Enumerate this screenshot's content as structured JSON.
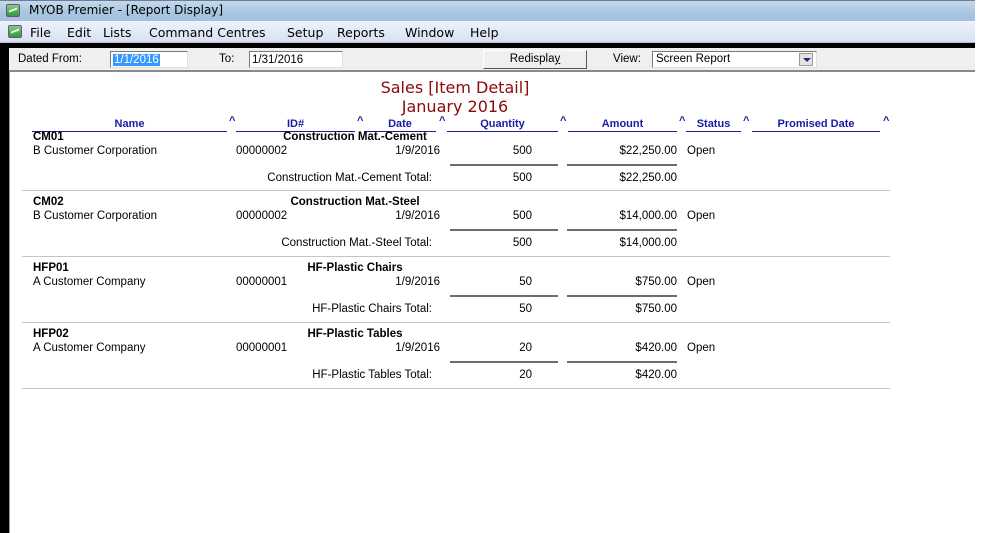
{
  "window": {
    "title": "MYOB Premier - [Report Display]",
    "app_icon": "myob-app-icon"
  },
  "menu": {
    "icon": "myob-document-icon",
    "items": [
      "File",
      "Edit",
      "Lists",
      "Command Centres",
      "Setup",
      "Reports",
      "Window",
      "Help"
    ]
  },
  "toolbar": {
    "dated_from_label": "Dated From:",
    "dated_from_value": "1/1/2016",
    "to_label": "To:",
    "to_value": "1/31/2016",
    "redisplay_label": "Redispla",
    "redisplay_mnemonic": "y",
    "view_label": "View:",
    "view_value": "Screen Report"
  },
  "report": {
    "title": "Sales [Item Detail]",
    "period": "January 2016",
    "columns": [
      "Name",
      "ID#",
      "Date",
      "Quantity",
      "Amount",
      "Status",
      "Promised Date"
    ],
    "sort_glyph": "^",
    "groups": [
      {
        "code": "CM01",
        "item_name": "Construction Mat.-Cement",
        "rows": [
          {
            "name": "B Customer Corporation",
            "id": "00000002",
            "date": "1/9/2016",
            "quantity": "500",
            "amount": "$22,250.00",
            "status": "Open",
            "promised_date": ""
          }
        ],
        "total_label": "Construction Mat.-Cement Total:",
        "total_quantity": "500",
        "total_amount": "$22,250.00"
      },
      {
        "code": "CM02",
        "item_name": "Construction Mat.-Steel",
        "rows": [
          {
            "name": "B Customer Corporation",
            "id": "00000002",
            "date": "1/9/2016",
            "quantity": "500",
            "amount": "$14,000.00",
            "status": "Open",
            "promised_date": ""
          }
        ],
        "total_label": "Construction Mat.-Steel Total:",
        "total_quantity": "500",
        "total_amount": "$14,000.00"
      },
      {
        "code": "HFP01",
        "item_name": "HF-Plastic Chairs",
        "rows": [
          {
            "name": "A Customer Company",
            "id": "00000001",
            "date": "1/9/2016",
            "quantity": "50",
            "amount": "$750.00",
            "status": "Open",
            "promised_date": ""
          }
        ],
        "total_label": "HF-Plastic Chairs Total:",
        "total_quantity": "50",
        "total_amount": "$750.00"
      },
      {
        "code": "HFP02",
        "item_name": "HF-Plastic Tables",
        "rows": [
          {
            "name": "A Customer Company",
            "id": "00000001",
            "date": "1/9/2016",
            "quantity": "20",
            "amount": "$420.00",
            "status": "Open",
            "promised_date": ""
          }
        ],
        "total_label": "HF-Plastic Tables Total:",
        "total_quantity": "20",
        "total_amount": "$420.00"
      }
    ]
  },
  "colors": {
    "report_title": "#8b0a0a",
    "column_header": "#1a1aa8",
    "selection": "#3399ff"
  }
}
